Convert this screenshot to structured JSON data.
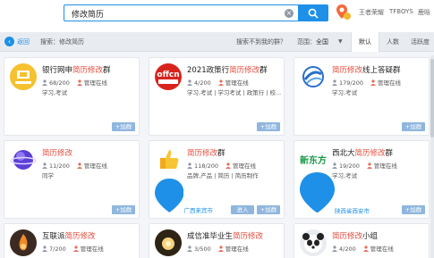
{
  "search": {
    "value": "修改简历"
  },
  "hot_words": [
    "王者荣耀",
    "TFBOYS",
    "鹿晗"
  ],
  "nav": {
    "back_label": "返回",
    "breadcrumb": "搜索：修改简历",
    "hint": "搜索不到我的群？",
    "range_label": "范围：",
    "range_value": "全国",
    "sort_tabs": [
      "默认",
      "人数",
      "活跃度"
    ]
  },
  "cards": [
    {
      "name_pre": "银行网申",
      "name_hl": "简历修改",
      "name_post": "群",
      "members": "68/200",
      "status": "管理在线",
      "tags": "学习,考试",
      "avatar": "bank",
      "loc": "",
      "enter": "",
      "join": "+加群"
    },
    {
      "name_pre": "2021政策行",
      "name_hl": "简历修改",
      "name_post": "群",
      "members": "4/200",
      "status": "管理在线",
      "tags": "学习,考试 | 学习考试 | 政策行 | 校...",
      "avatar": "offcn",
      "loc": "",
      "enter": "",
      "join": "+加群"
    },
    {
      "name_pre": "",
      "name_hl": "简历修改",
      "name_post": "线上答疑群",
      "members": "179/200",
      "status": "管理在线",
      "tags": "学习,考试",
      "avatar": "globe-logo",
      "loc": "",
      "enter": "",
      "join": "+加群"
    },
    {
      "name_pre": "",
      "name_hl": "简历修改",
      "name_post": "",
      "members": "11/200",
      "status": "管理在线",
      "tags": "同学",
      "avatar": "planet",
      "loc": "",
      "enter": "",
      "join": "+加群"
    },
    {
      "name_pre": "",
      "name_hl": "简历修改",
      "name_post": "群",
      "members": "118/200",
      "status": "管理在线",
      "tags": "品牌,产品 | 简历 | 简历制作",
      "avatar": "thumb",
      "loc": "广西来宾市",
      "enter": "进入",
      "join": "+加群"
    },
    {
      "name_pre": "西北大",
      "name_hl": "简历修改",
      "name_post": "群",
      "members": "19/200",
      "status": "管理在线",
      "tags": "学习,考试",
      "avatar": "xdf",
      "loc": "陕西省西安市",
      "enter": "",
      "join": "+加群"
    },
    {
      "name_pre": "互联派",
      "name_hl": "简历修改",
      "name_post": "",
      "members": "7/200",
      "status": "管理在线",
      "tags": "",
      "avatar": "fire",
      "loc": "",
      "enter": "",
      "join": ""
    },
    {
      "name_pre": "成信准毕业生",
      "name_hl": "简历修改",
      "name_post": "",
      "members": "3/500",
      "status": "管理在线",
      "tags": "",
      "avatar": "sparkle",
      "loc": "",
      "enter": "",
      "join": ""
    },
    {
      "name_pre": "",
      "name_hl": "简历修改",
      "name_post": "小组",
      "members": "4/200",
      "status": "管理在线",
      "tags": "",
      "avatar": "panda",
      "loc": "",
      "enter": "",
      "join": ""
    }
  ],
  "colors": {
    "accent": "#1e90e8",
    "highlight": "#e74c3c",
    "button": "#8fb6de"
  }
}
